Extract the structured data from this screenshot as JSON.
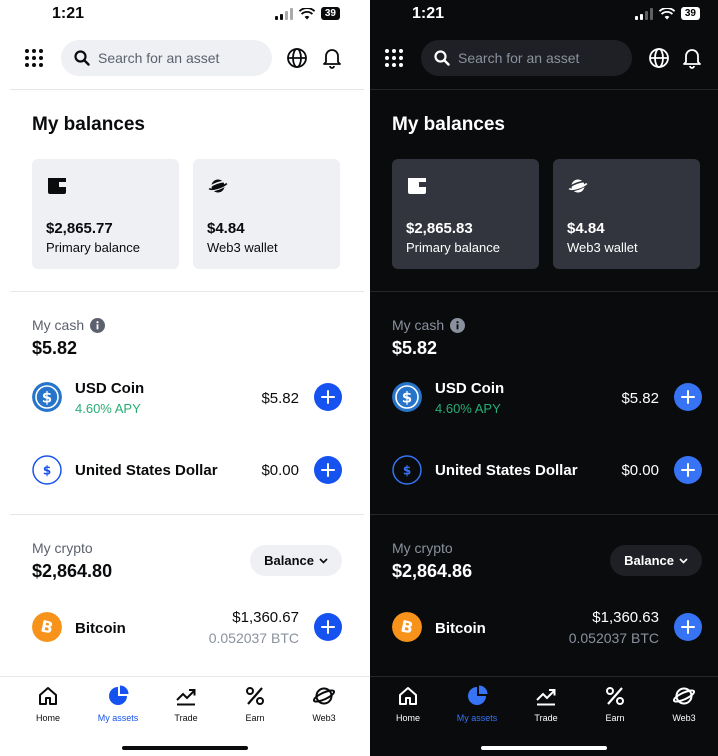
{
  "colors": {
    "accent_light": "#1652f0",
    "accent_dark": "#3773f5",
    "apy_green": "#27ad75",
    "btc_orange": "#f7931a",
    "usdc_blue": "#2775ca"
  },
  "status_bar": {
    "time": "1:21",
    "battery": "39"
  },
  "search": {
    "placeholder": "Search for an asset"
  },
  "balances": {
    "title": "My balances",
    "light": {
      "primary": {
        "amount": "$2,865.77",
        "label": "Primary balance",
        "icon": "wallet-icon"
      },
      "web3": {
        "amount": "$4.84",
        "label": "Web3 wallet",
        "icon": "planet-icon"
      }
    },
    "dark": {
      "primary": {
        "amount": "$2,865.83",
        "label": "Primary balance",
        "icon": "wallet-icon"
      },
      "web3": {
        "amount": "$4.84",
        "label": "Web3 wallet",
        "icon": "planet-icon"
      }
    }
  },
  "cash": {
    "label": "My cash",
    "total": "$5.82",
    "items": [
      {
        "name": "USD Coin",
        "apy": "4.60% APY",
        "value": "$5.82",
        "icon": "usdc-icon"
      },
      {
        "name": "United States Dollar",
        "value": "$0.00",
        "icon": "usd-icon"
      }
    ]
  },
  "crypto": {
    "label": "My crypto",
    "sort_button": "Balance",
    "light": {
      "total": "$2,864.80",
      "items": [
        {
          "name": "Bitcoin",
          "value": "$1,360.67",
          "amount": "0.052037 BTC",
          "icon": "bitcoin-icon"
        }
      ]
    },
    "dark": {
      "total": "$2,864.86",
      "items": [
        {
          "name": "Bitcoin",
          "value": "$1,360.63",
          "amount": "0.052037 BTC",
          "icon": "bitcoin-icon"
        }
      ]
    }
  },
  "tabs": [
    {
      "label": "Home",
      "icon": "home-icon"
    },
    {
      "label": "My assets",
      "icon": "pie-chart-icon",
      "active": true
    },
    {
      "label": "Trade",
      "icon": "trend-icon"
    },
    {
      "label": "Earn",
      "icon": "percent-icon"
    },
    {
      "label": "Web3",
      "icon": "web3-icon"
    }
  ]
}
